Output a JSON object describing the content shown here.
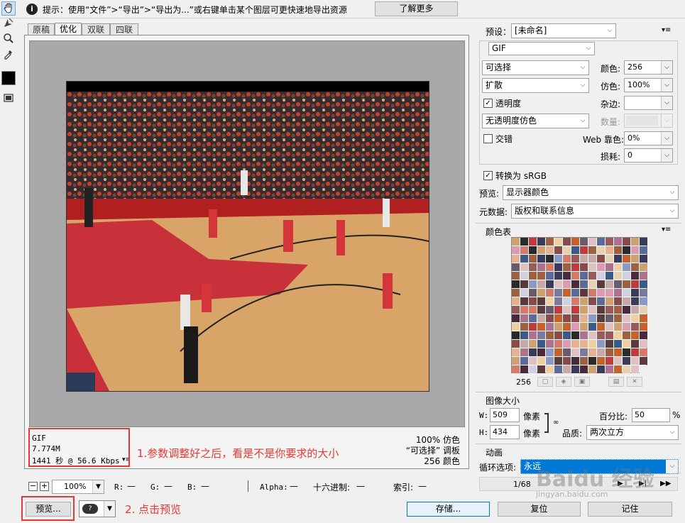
{
  "top": {
    "info_icon": "info-circle-icon",
    "hint": "提示：使用“文件”>“导出”>“导出为...”或右键单击某个图层可更快速地导出资源",
    "learn_more": "了解更多"
  },
  "tabs": [
    "原稿",
    "优化",
    "双联",
    "四联"
  ],
  "active_tab": 1,
  "tools": [
    "hand-icon",
    "slice-select-icon",
    "zoom-icon",
    "eyedropper-icon",
    "color-swatch-icon",
    "toggle-slices-icon"
  ],
  "status_left": {
    "format": "GIF",
    "size": "7.774M",
    "time": "1441 秒 @ 56.6 Kbps"
  },
  "status_right": {
    "dither": "100% 仿色",
    "palette": "“可选择” 调板",
    "colors": "256 颜色"
  },
  "annotations": {
    "note1": "1.参数调整好之后，看是不是你要求的大小",
    "note2": "2. 点击预览"
  },
  "bottom_bar": {
    "zoom": "100%",
    "r_label": "R:",
    "r_val": "—",
    "g_label": "G:",
    "g_val": "—",
    "b_label": "B:",
    "b_val": "—",
    "alpha_label": "Alpha:",
    "alpha_val": "—",
    "hex_label": "十六进制:",
    "hex_val": "—",
    "index_label": "索引:",
    "index_val": "—"
  },
  "footer": {
    "preview": "预览...",
    "save": "存储...",
    "reset": "复位",
    "remember": "记住"
  },
  "settings": {
    "preset_label": "预设：",
    "preset_value": "[未命名]",
    "format": "GIF",
    "palette_algo": "可选择",
    "colors_label": "颜色:",
    "colors_value": "256",
    "dither_algo": "扩散",
    "dither_label": "仿色:",
    "dither_value": "100%",
    "transparency": "透明度",
    "matte_label": "杂边:",
    "trans_dither": "无透明度仿色",
    "amount_label": "数量:",
    "interlaced": "交错",
    "websnap_label": "Web 靠色:",
    "websnap_value": "0%",
    "lossy_label": "损耗:",
    "lossy_value": "0",
    "convert_srgb": "转换为 sRGB",
    "preview_label": "预览:",
    "preview_value": "显示器颜色",
    "metadata_label": "元数据:",
    "metadata_value": "版权和联系信息"
  },
  "color_table": {
    "title": "颜色表",
    "count": "256"
  },
  "image_size": {
    "title": "图像大小",
    "w_label": "W:",
    "w_value": "509",
    "h_label": "H:",
    "h_value": "434",
    "unit": "像素",
    "percent_label": "百分比:",
    "percent_value": "50",
    "percent_unit": "%",
    "quality_label": "品质:",
    "quality_value": "两次立方"
  },
  "animation": {
    "title": "动画",
    "loop_label": "循环选项:",
    "loop_value": "永远",
    "frame": "1/68"
  },
  "watermark": "Baidu 经验",
  "watermark_url": "jingyan.baidu.com"
}
